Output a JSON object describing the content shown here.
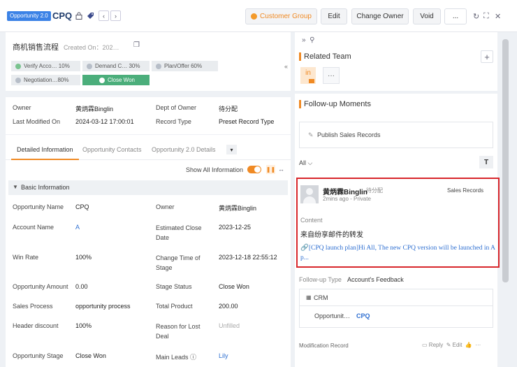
{
  "header": {
    "object_tag": "Opportunity 2.0",
    "record_title": "CPQ",
    "buttons": {
      "customer_group": "Customer Group",
      "edit": "Edit",
      "change_owner": "Change Owner",
      "void": "Void",
      "more": "..."
    }
  },
  "title_panel": {
    "name": "商机销售流程",
    "created": "Created On：202…",
    "stages": [
      {
        "label": "Verify Acco… 10%"
      },
      {
        "label": "Demand C… 30%"
      },
      {
        "label": "Plan/Offer   60%"
      },
      {
        "label": "Negotiation…80%"
      },
      {
        "label": "Close Won"
      }
    ]
  },
  "owner_panel": {
    "owner_label": "Owner",
    "owner_value": "黄炳霖Binglin",
    "dept_label": "Dept of Owner",
    "dept_value": "待分配",
    "modified_label": "Last Modified On",
    "modified_value": "2024-03-12 17:00:01",
    "record_type_label": "Record Type",
    "record_type_value": "Preset Record Type"
  },
  "detail_panel": {
    "tabs": [
      "Detailed Information",
      "Opportunity Contacts",
      "Opportunity 2.0 Details"
    ],
    "show_all": "Show All Information",
    "section": "Basic Information",
    "fields": {
      "opp_name_label": "Opportunity Name",
      "opp_name_value": "CPQ",
      "owner_label": "Owner",
      "owner_value": "黄炳霖Binglin",
      "account_label": "Account Name",
      "account_value": "A",
      "close_date_label": "Estimated Close Date",
      "close_date_value": "2023-12-25",
      "win_rate_label": "Win Rate",
      "win_rate_value": "100%",
      "change_time_label": "Change Time of Stage",
      "change_time_value": "2023-12-18 22:55:12",
      "amount_label": "Opportunity Amount",
      "amount_value": "0.00",
      "stage_status_label": "Stage Status",
      "stage_status_value": "Close Won",
      "process_label": "Sales Process",
      "process_value": "opportunity process",
      "total_product_label": "Total Product",
      "total_product_value": "200.00",
      "discount_label": "Header discount",
      "discount_value": "100%",
      "reason_label": "Reason for Lost Deal",
      "reason_value": "Unfilled",
      "opp_stage_label": "Opportunity Stage",
      "opp_stage_value": "Close Won",
      "main_leads_label": "Main Leads",
      "main_leads_value": "Lily"
    }
  },
  "team_panel": {
    "title": "Related Team",
    "member_avatar": "in",
    "more": "···"
  },
  "follow_panel": {
    "title": "Follow-up Moments",
    "publish": "Publish Sales Records",
    "filter": "All",
    "filter_btn": "T",
    "moment": {
      "author": "黄炳霖Binglin",
      "status": "待分配",
      "meta": "2mins ago - Private",
      "type": "Sales Records",
      "content_label": "Content",
      "content_text": "来自纷享邮件的转发",
      "link_text": "[CPQ launch plan]Hi All, The new CPQ version will be launched in A p..."
    },
    "followup_type_label": "Follow-up Type",
    "followup_type_value": "Account's Feedback",
    "crm_label": "CRM",
    "opportunity_label": "Opportunit…",
    "opportunity_value": "CPQ",
    "mod_record": "Modification Record",
    "actions": {
      "reply": "Reply",
      "edit": "Edit"
    }
  }
}
